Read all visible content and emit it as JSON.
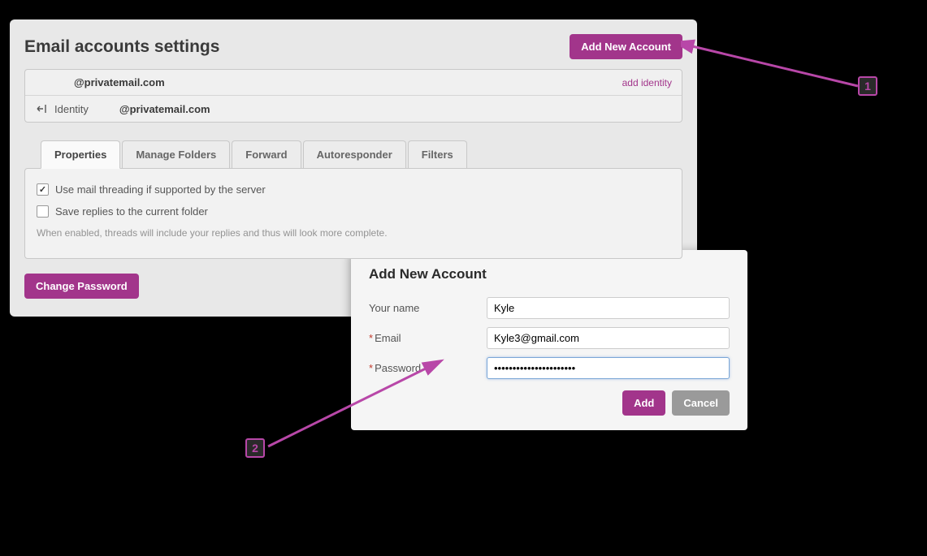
{
  "header": {
    "title": "Email accounts settings",
    "add_button": "Add New Account"
  },
  "account": {
    "email": "@privatemail.com",
    "add_identity": "add identity",
    "identity_label": "Identity",
    "identity_email": "@privatemail.com"
  },
  "tabs": [
    {
      "label": "Properties",
      "active": true
    },
    {
      "label": "Manage Folders"
    },
    {
      "label": "Forward"
    },
    {
      "label": "Autoresponder"
    },
    {
      "label": "Filters"
    }
  ],
  "properties": {
    "threading_label": "Use mail threading if supported by the server",
    "threading_checked": true,
    "replies_label": "Save replies to the current folder",
    "replies_checked": false,
    "help": "When enabled, threads will include your replies and thus will look more complete."
  },
  "change_password": "Change Password",
  "modal": {
    "title": "Add New Account",
    "name_label": "Your name",
    "name_value": "Kyle",
    "email_label": "Email",
    "email_value": "Kyle3@gmail.com",
    "password_label": "Password",
    "password_value": "••••••••••••••••••••••",
    "add_btn": "Add",
    "cancel_btn": "Cancel"
  },
  "annotations": {
    "one": "1",
    "two": "2"
  }
}
